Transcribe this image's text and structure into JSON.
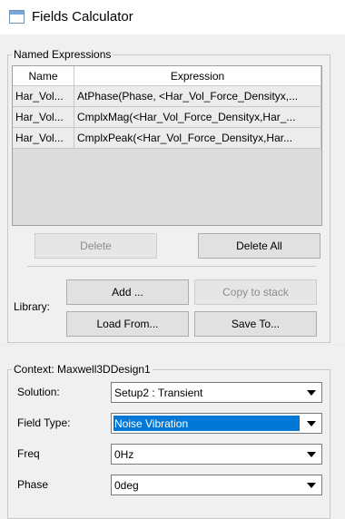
{
  "window": {
    "title": "Fields Calculator"
  },
  "named_expressions": {
    "legend": "Named Expressions",
    "columns": [
      "Name",
      "Expression"
    ],
    "rows": [
      {
        "name": "Har_Vol...",
        "expression": "AtPhase(Phase, <Har_Vol_Force_Densityx,..."
      },
      {
        "name": "Har_Vol...",
        "expression": "CmplxMag(<Har_Vol_Force_Densityx,Har_..."
      },
      {
        "name": "Har_Vol...",
        "expression": "CmplxPeak(<Har_Vol_Force_Densityx,Har..."
      }
    ],
    "delete_label": "Delete",
    "delete_all_label": "Delete All",
    "library_label": "Library:",
    "add_label": "Add ...",
    "copy_to_stack_label": "Copy to stack",
    "load_from_label": "Load From...",
    "save_to_label": "Save To..."
  },
  "context": {
    "legend": "Context: Maxwell3DDesign1",
    "solution_label": "Solution:",
    "solution_value": "Setup2 : Transient",
    "field_type_label": "Field Type:",
    "field_type_value": "Noise Vibration",
    "freq_label": "Freq",
    "freq_value": "0Hz",
    "phase_label": "Phase",
    "phase_value": "0deg"
  }
}
